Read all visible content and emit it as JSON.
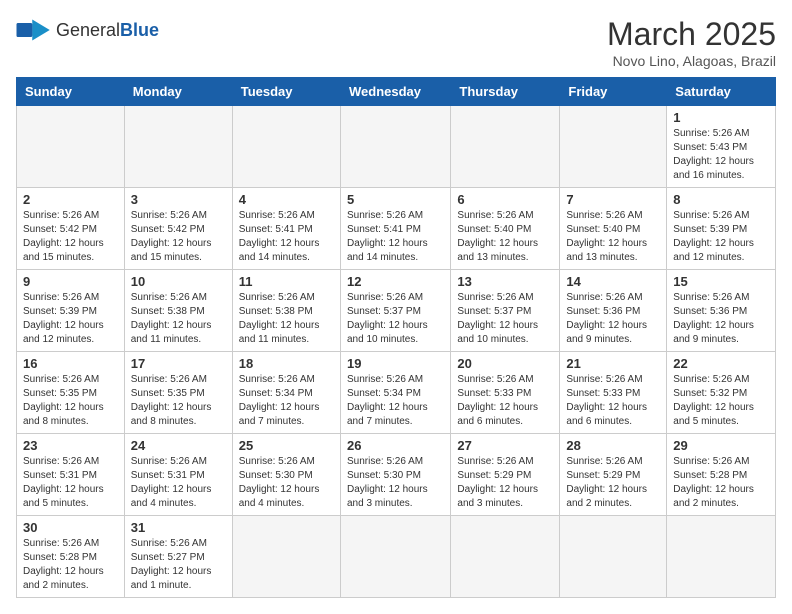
{
  "logo": {
    "text_general": "General",
    "text_blue": "Blue"
  },
  "header": {
    "month": "March 2025",
    "location": "Novo Lino, Alagoas, Brazil"
  },
  "weekdays": [
    "Sunday",
    "Monday",
    "Tuesday",
    "Wednesday",
    "Thursday",
    "Friday",
    "Saturday"
  ],
  "weeks": [
    [
      {
        "day": "",
        "info": ""
      },
      {
        "day": "",
        "info": ""
      },
      {
        "day": "",
        "info": ""
      },
      {
        "day": "",
        "info": ""
      },
      {
        "day": "",
        "info": ""
      },
      {
        "day": "",
        "info": ""
      },
      {
        "day": "1",
        "info": "Sunrise: 5:26 AM\nSunset: 5:43 PM\nDaylight: 12 hours and 16 minutes."
      }
    ],
    [
      {
        "day": "2",
        "info": "Sunrise: 5:26 AM\nSunset: 5:42 PM\nDaylight: 12 hours and 15 minutes."
      },
      {
        "day": "3",
        "info": "Sunrise: 5:26 AM\nSunset: 5:42 PM\nDaylight: 12 hours and 15 minutes."
      },
      {
        "day": "4",
        "info": "Sunrise: 5:26 AM\nSunset: 5:41 PM\nDaylight: 12 hours and 14 minutes."
      },
      {
        "day": "5",
        "info": "Sunrise: 5:26 AM\nSunset: 5:41 PM\nDaylight: 12 hours and 14 minutes."
      },
      {
        "day": "6",
        "info": "Sunrise: 5:26 AM\nSunset: 5:40 PM\nDaylight: 12 hours and 13 minutes."
      },
      {
        "day": "7",
        "info": "Sunrise: 5:26 AM\nSunset: 5:40 PM\nDaylight: 12 hours and 13 minutes."
      },
      {
        "day": "8",
        "info": "Sunrise: 5:26 AM\nSunset: 5:39 PM\nDaylight: 12 hours and 12 minutes."
      }
    ],
    [
      {
        "day": "9",
        "info": "Sunrise: 5:26 AM\nSunset: 5:39 PM\nDaylight: 12 hours and 12 minutes."
      },
      {
        "day": "10",
        "info": "Sunrise: 5:26 AM\nSunset: 5:38 PM\nDaylight: 12 hours and 11 minutes."
      },
      {
        "day": "11",
        "info": "Sunrise: 5:26 AM\nSunset: 5:38 PM\nDaylight: 12 hours and 11 minutes."
      },
      {
        "day": "12",
        "info": "Sunrise: 5:26 AM\nSunset: 5:37 PM\nDaylight: 12 hours and 10 minutes."
      },
      {
        "day": "13",
        "info": "Sunrise: 5:26 AM\nSunset: 5:37 PM\nDaylight: 12 hours and 10 minutes."
      },
      {
        "day": "14",
        "info": "Sunrise: 5:26 AM\nSunset: 5:36 PM\nDaylight: 12 hours and 9 minutes."
      },
      {
        "day": "15",
        "info": "Sunrise: 5:26 AM\nSunset: 5:36 PM\nDaylight: 12 hours and 9 minutes."
      }
    ],
    [
      {
        "day": "16",
        "info": "Sunrise: 5:26 AM\nSunset: 5:35 PM\nDaylight: 12 hours and 8 minutes."
      },
      {
        "day": "17",
        "info": "Sunrise: 5:26 AM\nSunset: 5:35 PM\nDaylight: 12 hours and 8 minutes."
      },
      {
        "day": "18",
        "info": "Sunrise: 5:26 AM\nSunset: 5:34 PM\nDaylight: 12 hours and 7 minutes."
      },
      {
        "day": "19",
        "info": "Sunrise: 5:26 AM\nSunset: 5:34 PM\nDaylight: 12 hours and 7 minutes."
      },
      {
        "day": "20",
        "info": "Sunrise: 5:26 AM\nSunset: 5:33 PM\nDaylight: 12 hours and 6 minutes."
      },
      {
        "day": "21",
        "info": "Sunrise: 5:26 AM\nSunset: 5:33 PM\nDaylight: 12 hours and 6 minutes."
      },
      {
        "day": "22",
        "info": "Sunrise: 5:26 AM\nSunset: 5:32 PM\nDaylight: 12 hours and 5 minutes."
      }
    ],
    [
      {
        "day": "23",
        "info": "Sunrise: 5:26 AM\nSunset: 5:31 PM\nDaylight: 12 hours and 5 minutes."
      },
      {
        "day": "24",
        "info": "Sunrise: 5:26 AM\nSunset: 5:31 PM\nDaylight: 12 hours and 4 minutes."
      },
      {
        "day": "25",
        "info": "Sunrise: 5:26 AM\nSunset: 5:30 PM\nDaylight: 12 hours and 4 minutes."
      },
      {
        "day": "26",
        "info": "Sunrise: 5:26 AM\nSunset: 5:30 PM\nDaylight: 12 hours and 3 minutes."
      },
      {
        "day": "27",
        "info": "Sunrise: 5:26 AM\nSunset: 5:29 PM\nDaylight: 12 hours and 3 minutes."
      },
      {
        "day": "28",
        "info": "Sunrise: 5:26 AM\nSunset: 5:29 PM\nDaylight: 12 hours and 2 minutes."
      },
      {
        "day": "29",
        "info": "Sunrise: 5:26 AM\nSunset: 5:28 PM\nDaylight: 12 hours and 2 minutes."
      }
    ],
    [
      {
        "day": "30",
        "info": "Sunrise: 5:26 AM\nSunset: 5:28 PM\nDaylight: 12 hours and 2 minutes."
      },
      {
        "day": "31",
        "info": "Sunrise: 5:26 AM\nSunset: 5:27 PM\nDaylight: 12 hours and 1 minute."
      },
      {
        "day": "",
        "info": ""
      },
      {
        "day": "",
        "info": ""
      },
      {
        "day": "",
        "info": ""
      },
      {
        "day": "",
        "info": ""
      },
      {
        "day": "",
        "info": ""
      }
    ]
  ]
}
